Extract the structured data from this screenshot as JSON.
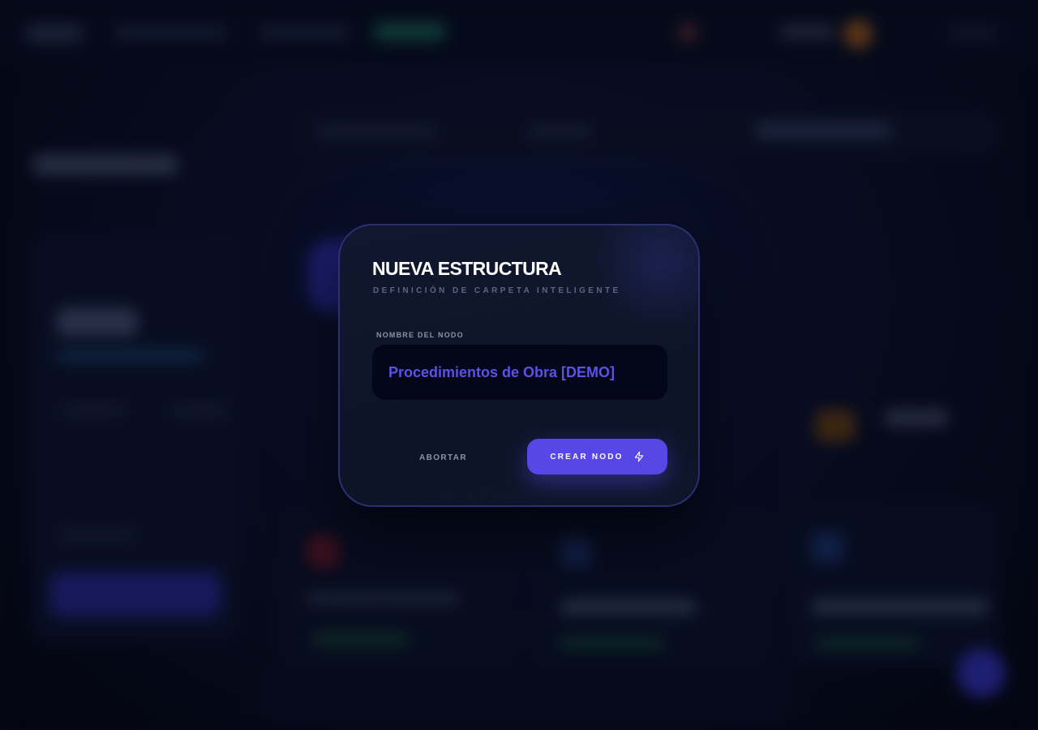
{
  "modal": {
    "title": "NUEVA ESTRUCTURA",
    "subtitle": "DEFINICIÓN DE CARPETA INTELIGENTE",
    "field_label": "NOMBRE DEL NODO",
    "field_value": "Procedimientos de Obra [DEMO]",
    "cancel_label": "ABORTAR",
    "create_label": "CREAR NODO",
    "create_icon": "lightning-icon"
  },
  "colors": {
    "accent": "#5747e6",
    "input_text": "#5b52e6",
    "background": "#050816",
    "modal_background": "#11172e"
  }
}
